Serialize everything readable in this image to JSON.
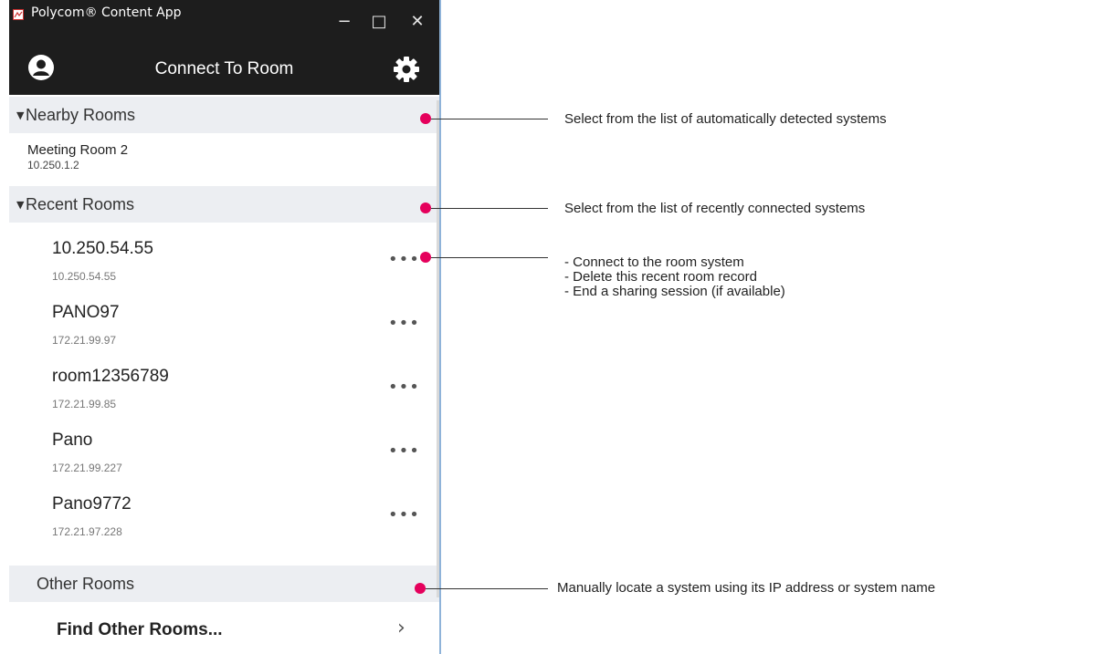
{
  "window": {
    "app_title": "Polycom® Content App",
    "min_glyph": "−",
    "max_glyph": "□",
    "close_glyph": "✕",
    "nav_title": "Connect To Room"
  },
  "sections": {
    "nearby": {
      "label": "Nearby Rooms",
      "rooms": [
        {
          "name": "Meeting Room 2",
          "ip": "10.250.1.2"
        }
      ]
    },
    "recent": {
      "label": "Recent Rooms",
      "rooms": [
        {
          "name": "10.250.54.55",
          "ip": "10.250.54.55"
        },
        {
          "name": "PANO97",
          "ip": "172.21.99.97"
        },
        {
          "name": "room12356789",
          "ip": "172.21.99.85"
        },
        {
          "name": "Pano",
          "ip": "172.21.99.227"
        },
        {
          "name": "Pano9772",
          "ip": "172.21.97.228"
        }
      ]
    },
    "other": {
      "label": "Other Rooms",
      "find_label": "Find Other Rooms..."
    }
  },
  "glyphs": {
    "triangle": "▼",
    "more": "•••",
    "chevron": "›"
  },
  "callouts": {
    "nearby": "Select from the list of automatically detected systems",
    "recent": "Select from the list of recently connected systems",
    "actions": [
      "- Connect to the room system",
      "- Delete this recent room record",
      "- End a sharing session (if available)"
    ],
    "other": "Manually locate a system using its IP address or system name"
  },
  "colors": {
    "title_bar": "#1d1d1d",
    "section_bg": "#eceef2",
    "callout_dot": "#e5005c",
    "window_border": "#8fb3d9"
  },
  "icons": {
    "app": "polycom-app-icon",
    "avatar": "user-avatar-icon",
    "settings": "gear-icon",
    "minimize": "minimize-icon",
    "maximize": "maximize-icon",
    "close": "close-icon",
    "expand": "triangle-down-icon",
    "more": "more-dots-icon",
    "next": "chevron-right-icon"
  }
}
